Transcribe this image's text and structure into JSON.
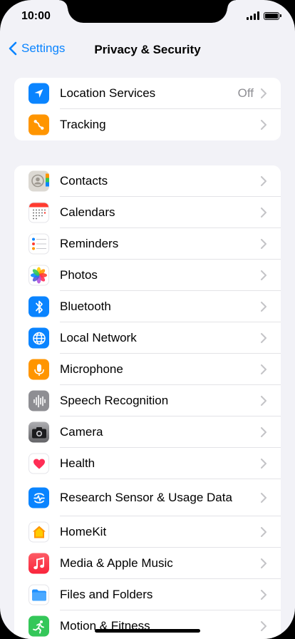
{
  "status": {
    "time": "10:00"
  },
  "nav": {
    "back_label": "Settings",
    "title": "Privacy & Security"
  },
  "group1": [
    {
      "label": "Location Services",
      "value": "Off",
      "icon": "location-arrow-icon",
      "color": "#0a84ff"
    },
    {
      "label": "Tracking",
      "icon": "tracking-icon",
      "color": "#ff9500"
    }
  ],
  "group2": [
    {
      "label": "Contacts",
      "icon": "contacts-icon",
      "color": "#d8d6d2"
    },
    {
      "label": "Calendars",
      "icon": "calendar-icon",
      "color": "#ffffff"
    },
    {
      "label": "Reminders",
      "icon": "reminders-icon",
      "color": "#ffffff"
    },
    {
      "label": "Photos",
      "icon": "photos-icon",
      "color": "#ffffff"
    },
    {
      "label": "Bluetooth",
      "icon": "bluetooth-icon",
      "color": "#0a84ff"
    },
    {
      "label": "Local Network",
      "icon": "globe-icon",
      "color": "#0a84ff"
    },
    {
      "label": "Microphone",
      "icon": "microphone-icon",
      "color": "#ff9500"
    },
    {
      "label": "Speech Recognition",
      "icon": "waveform-icon",
      "color": "#8e8e93"
    },
    {
      "label": "Camera",
      "icon": "camera-icon",
      "color": "#8e8e93"
    },
    {
      "label": "Health",
      "icon": "heart-icon",
      "color": "#ffffff"
    },
    {
      "label": "Research Sensor & Usage Data",
      "icon": "research-icon",
      "color": "#0a84ff"
    },
    {
      "label": "HomeKit",
      "icon": "home-icon",
      "color": "#ffffff"
    },
    {
      "label": "Media & Apple Music",
      "icon": "music-note-icon",
      "color": "#fc3c44"
    },
    {
      "label": "Files and Folders",
      "icon": "folder-icon",
      "color": "#ffffff"
    },
    {
      "label": "Motion & Fitness",
      "icon": "fitness-icon",
      "color": "#34c759"
    }
  ]
}
